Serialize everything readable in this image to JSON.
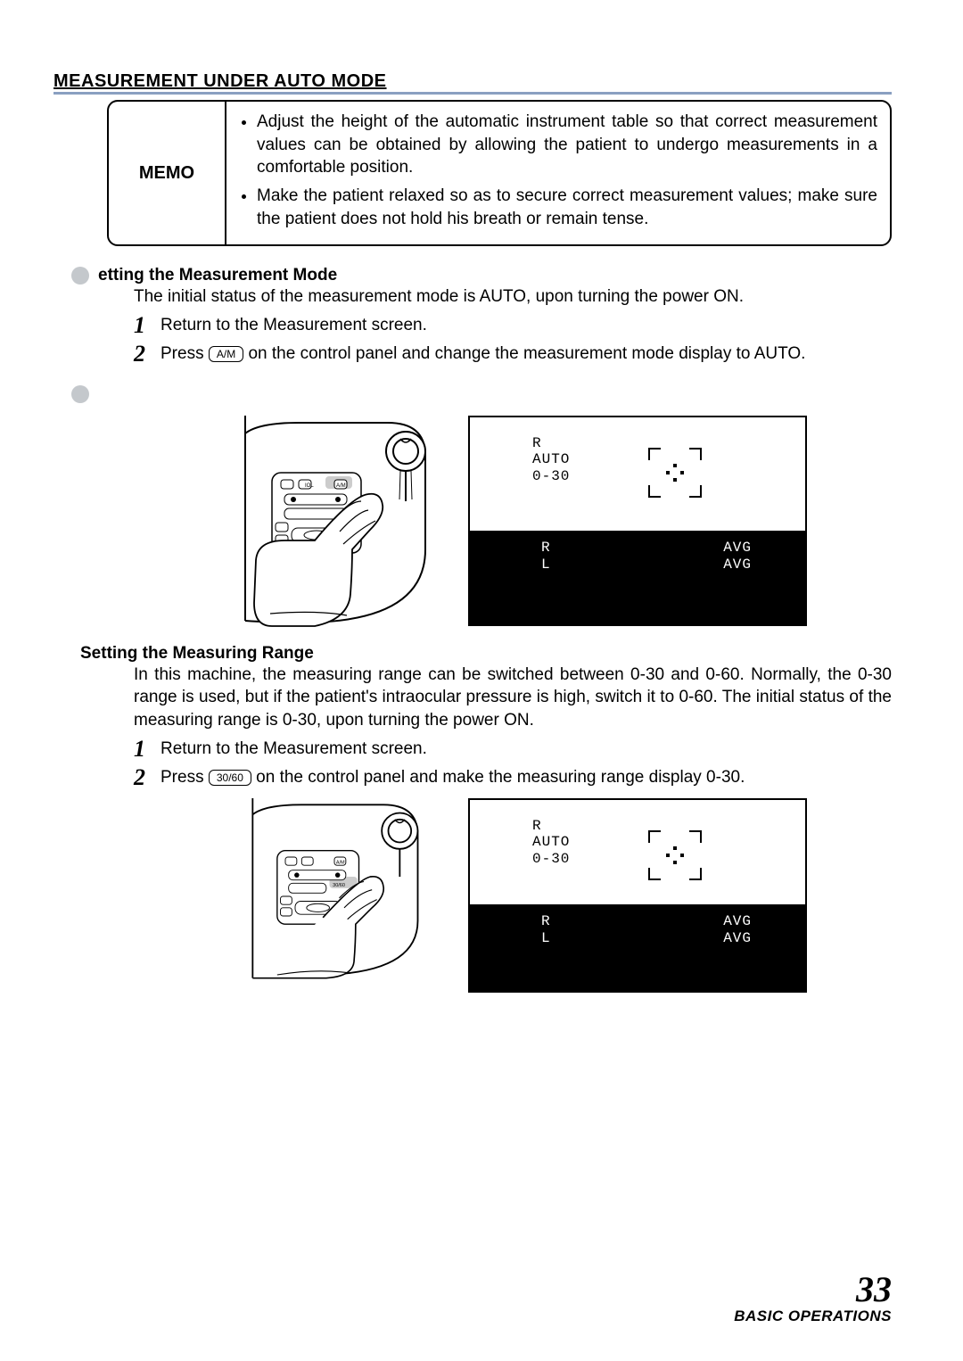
{
  "main_heading": "MEASUREMENT UNDER AUTO MODE",
  "memo": {
    "label": "MEMO",
    "items": [
      "Adjust the height of the automatic instrument table so that correct measurement values can be obtained by allowing the patient to undergo measurements in a comfortable position.",
      "Make the patient relaxed so as to secure correct measurement values; make sure the patient does not hold his breath or remain tense."
    ]
  },
  "section1": {
    "heading": "etting the Measurement Mode",
    "intro": "The initial status of the measurement mode is AUTO, upon turning the power ON.",
    "step1": "Return to the Measurement screen.",
    "step2a": "Press ",
    "step2_key": "A/M",
    "step2b": " on the control panel and change the measurement mode display to AUTO."
  },
  "section2": {
    "heading": "Setting the Measuring Range",
    "intro": "In this machine, the measuring range can be switched between 0-30 and 0-60. Normally, the 0-30 range is used, but if the patient's intraocular pressure is high, switch it to 0-60.  The initial status of the measuring range is 0-30, upon turning the power ON.",
    "step1": "Return to the Measurement screen.",
    "step2a": "Press ",
    "step2_key": "30/60",
    "step2b": " on the control panel and make the measuring range display 0-30."
  },
  "screen": {
    "top_lines": "R\nAUTO\n0-30",
    "rl": "R\nL",
    "avg": "AVG\nAVG"
  },
  "footer": {
    "page": "33",
    "section": "BASIC OPERATIONS"
  }
}
